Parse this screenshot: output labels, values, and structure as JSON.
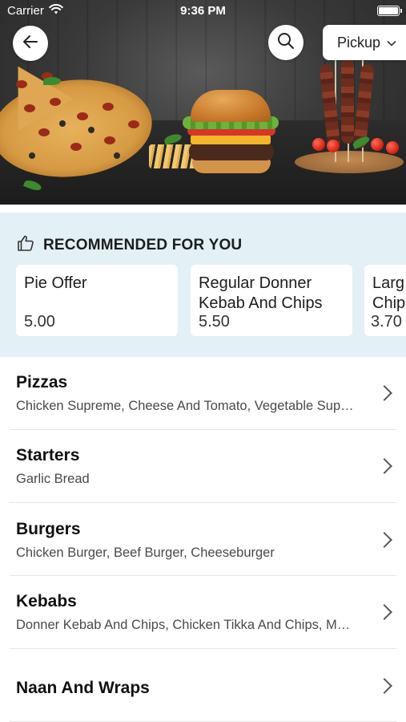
{
  "status_bar": {
    "carrier": "Carrier",
    "time": "9:36 PM"
  },
  "header": {
    "back_icon": "back-arrow-icon",
    "search_icon": "search-icon",
    "order_mode": "Pickup"
  },
  "recommended": {
    "title": "RECOMMENDED FOR YOU",
    "icon": "thumbs-up-icon",
    "items": [
      {
        "name": "Pie Offer",
        "price": "5.00"
      },
      {
        "name": "Regular Donner Kebab And Chips",
        "price": "5.50"
      },
      {
        "name": "Larg Chip",
        "price": "3.70"
      }
    ]
  },
  "categories": [
    {
      "name": "Pizzas",
      "items": "Chicken Supreme, Cheese And Tomato, Vegetable Sup…"
    },
    {
      "name": "Starters",
      "items": "Garlic Bread"
    },
    {
      "name": "Burgers",
      "items": "Chicken Burger, Beef Burger, Cheeseburger"
    },
    {
      "name": "Kebabs",
      "items": "Donner Kebab And Chips, Chicken Tikka And Chips, M…"
    },
    {
      "name": "Naan And Wraps",
      "items": ""
    }
  ],
  "colors": {
    "recommended_bg": "#e3f0f6",
    "card_bg": "#ffffff",
    "text_primary": "#111111",
    "text_secondary": "#4a4a4a"
  }
}
